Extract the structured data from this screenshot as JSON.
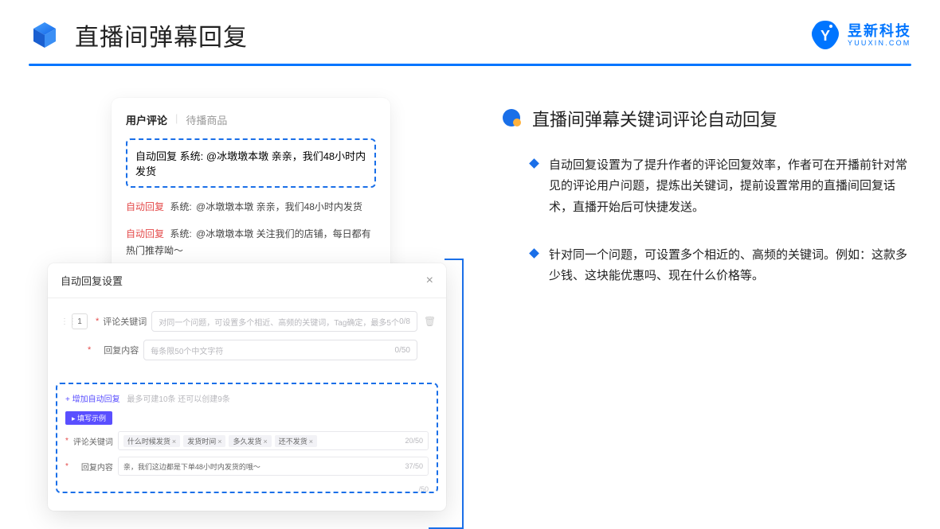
{
  "header": {
    "title": "直播间弹幕回复",
    "brand_cn": "昱新科技",
    "brand_en": "YUUXIN.COM"
  },
  "comments_panel": {
    "tab_active": "用户评论",
    "tab_other": "待播商品",
    "highlight": {
      "auto_reply": "自动回复",
      "system": "系统:",
      "text": "@冰墩墩本墩 亲亲，我们48小时内发货"
    },
    "items": [
      {
        "auto_reply": "自动回复",
        "system": "系统:",
        "text": "@冰墩墩本墩 亲亲，我们48小时内发货"
      },
      {
        "auto_reply": "自动回复",
        "system": "系统:",
        "text": "@冰墩墩本墩 关注我们的店铺，每日都有热门推荐呦～"
      }
    ]
  },
  "settings_panel": {
    "title": "自动回复设置",
    "idx": "1",
    "label_keyword": "评论关键词",
    "placeholder_keyword": "对同一个问题，可设置多个相近、高频的关键词，Tag确定，最多5个",
    "counter_keyword": "0/8",
    "label_content": "回复内容",
    "placeholder_content": "每条限50个中文字符",
    "counter_content": "0/50",
    "add_link": "+ 增加自动回复",
    "add_hint": "最多可建10条 还可以创建9条",
    "example_badge": "▸ 填写示例",
    "ex_label_keyword": "评论关键词",
    "ex_tags": [
      "什么时候发货",
      "发货时间",
      "多久发货",
      "还不发货"
    ],
    "ex_counter_keyword": "20/50",
    "ex_label_content": "回复内容",
    "ex_content": "亲，我们这边都是下单48小时内发货的哦～",
    "ex_counter_content": "37/50",
    "stray_counter": "/50"
  },
  "right": {
    "title": "直播间弹幕关键词评论自动回复",
    "bullets": [
      "自动回复设置为了提升作者的评论回复效率，作者可在开播前针对常见的评论用户问题，提炼出关键词，提前设置常用的直播间回复话术，直播开始后可快捷发送。",
      "针对同一个问题，可设置多个相近的、高频的关键词。例如：这款多少钱、这块能优惠吗、现在什么价格等。"
    ]
  }
}
